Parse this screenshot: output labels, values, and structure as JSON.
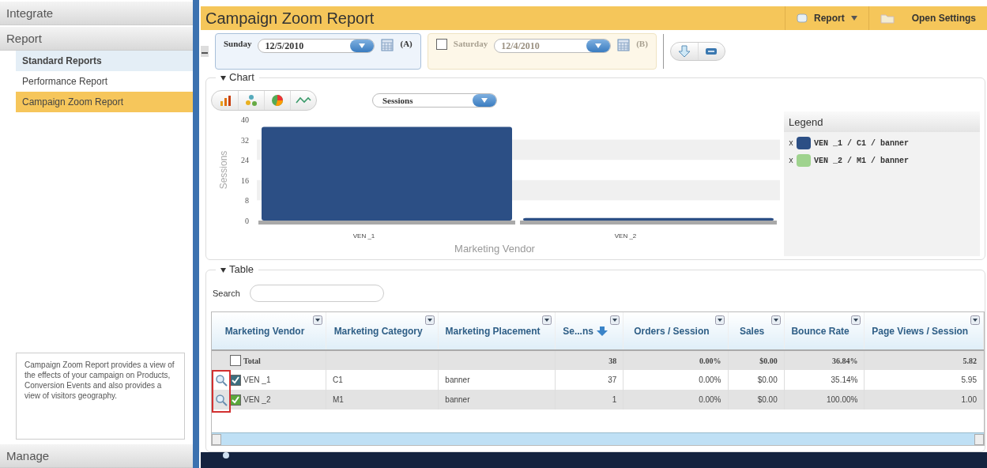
{
  "sidebar": {
    "top_headers": [
      "Integrate",
      "Report"
    ],
    "items": [
      {
        "label": "Standard Reports",
        "kind": "group",
        "selected": false
      },
      {
        "label": "Performance Report",
        "kind": "link",
        "selected": false
      },
      {
        "label": "Campaign Zoom Report",
        "kind": "link",
        "selected": true
      }
    ],
    "description": "Campaign Zoom Report provides a view of the effects of your campaign on Products, Conversion Events and also provides a view of visitors geography.",
    "bottom_header": "Manage"
  },
  "header": {
    "title": "Campaign Zoom Report",
    "report_button": "Report",
    "settings_button": "Open Settings"
  },
  "date_a": {
    "day": "Sunday",
    "date": "12/5/2010",
    "tag": "(A)",
    "disabled": false
  },
  "date_b": {
    "day": "Saturday",
    "date": "12/4/2010",
    "tag": "(B)",
    "disabled": true,
    "checked": false
  },
  "chart_section": {
    "title": "Chart",
    "chart_data": {
      "type": "bar",
      "xlabel": "Marketing Vendor",
      "ylabel": "Sessions",
      "categories": [
        "VEN _1",
        "VEN _2"
      ],
      "series": [
        {
          "name": "Sessions",
          "color": "#2c4f85",
          "values": [
            37,
            1
          ]
        }
      ],
      "ylim": [
        0,
        40
      ],
      "yticks": [
        0,
        8,
        16,
        24,
        32,
        40
      ]
    },
    "legend_title": "Legend",
    "legend": [
      {
        "label": "VEN _1 / C1 / banner",
        "color": "#2c4f85",
        "remove": "x"
      },
      {
        "label": "VEN _2 / M1 / banner",
        "color": "#9fd38e",
        "remove": "x"
      }
    ]
  },
  "table_section": {
    "title": "Table",
    "search_label": "Search",
    "columns": [
      {
        "label": "Marketing Vendor",
        "sorted": false
      },
      {
        "label": "Marketing Category",
        "sorted": false
      },
      {
        "label": "Marketing Placement",
        "sorted": false
      },
      {
        "label": "Se...ns",
        "sorted": true
      },
      {
        "label": "Orders / Session",
        "sorted": false
      },
      {
        "label": "Sales",
        "sorted": false
      },
      {
        "label": "Bounce Rate",
        "sorted": false
      },
      {
        "label": "Page Views / Session",
        "sorted": false
      }
    ],
    "rows": [
      {
        "kind": "total",
        "checked": false,
        "cells": [
          "Total",
          "",
          "",
          "38",
          "0.00%",
          "$0.00",
          "36.84%",
          "5.82"
        ]
      },
      {
        "kind": "item",
        "checked": true,
        "color": "#3d6e7e",
        "cells": [
          "VEN _1",
          "C1",
          "banner",
          "37",
          "0.00%",
          "$0.00",
          "35.14%",
          "5.95"
        ]
      },
      {
        "kind": "item",
        "checked": true,
        "color": "#5aa83c",
        "cells": [
          "VEN _2",
          "M1",
          "banner",
          "1",
          "0.00%",
          "$0.00",
          "100.00%",
          "1.00"
        ]
      }
    ]
  }
}
